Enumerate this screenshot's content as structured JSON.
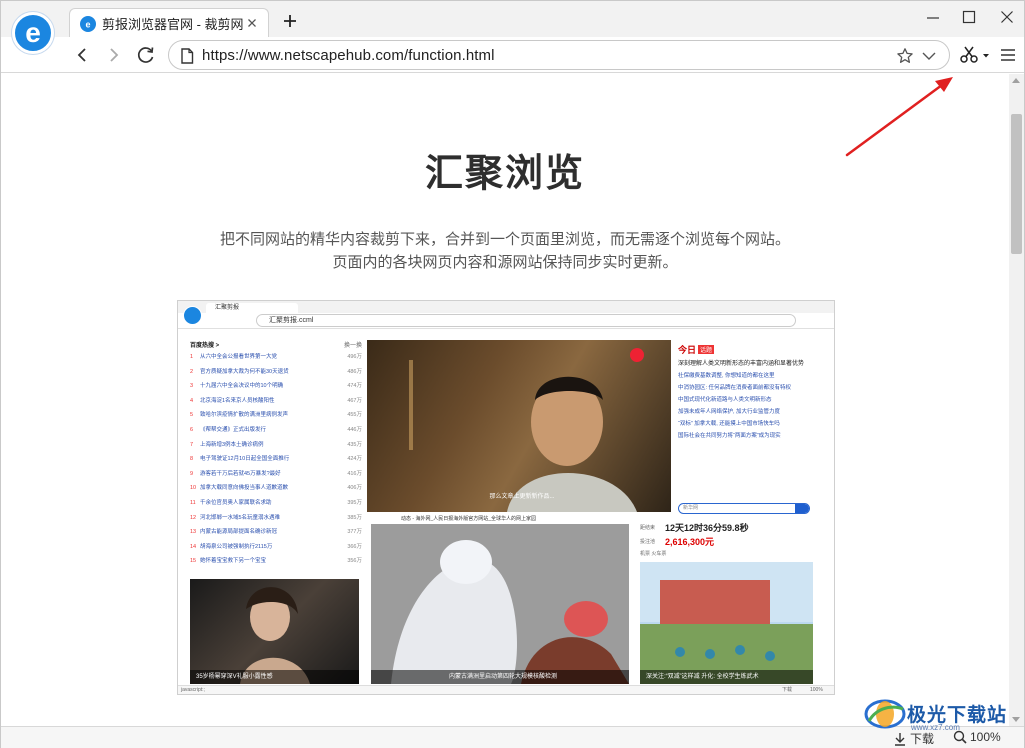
{
  "browser": {
    "tab_title": "剪报浏览器官网 - 裁剪网",
    "url": "https://www.netscapehub.com/function.html",
    "status_download_label": "下载",
    "zoom_level": "100%"
  },
  "icons": [
    "browser-logo-icon",
    "tab-favicon-icon",
    "tab-close-icon",
    "new-tab-icon",
    "minimize-icon",
    "maximize-icon",
    "close-icon",
    "back-icon",
    "forward-icon",
    "refresh-icon",
    "secure-page-icon",
    "star-icon",
    "address-dropdown-icon",
    "scissors-icon",
    "menu-icon",
    "download-icon",
    "zoom-icon",
    "red-annotation-arrow"
  ],
  "page": {
    "heading": "汇聚浏览",
    "description": "把不同网站的精华内容裁剪下来，合并到一个页面里浏览，而无需逐个浏览每个网站。页面内的各块网页内容和源网站保持同步实时更新。"
  },
  "preview": {
    "tab_title": "汇聚剪报",
    "address": "汇聚剪报.ccml",
    "status_text": "javascript:;",
    "status_download": "下载",
    "status_zoom": "100%",
    "hot_list": {
      "title": "百度热搜 >",
      "refresh": "换一换",
      "items": [
        {
          "rank": "1",
          "title": "从六中全会公报看世界第一大党",
          "count": "496万"
        },
        {
          "rank": "2",
          "title": "官方质疑加拿大裁为何不能30天退货",
          "count": "486万"
        },
        {
          "rank": "3",
          "title": "十九届六中全会决议中的10个明确",
          "count": "474万"
        },
        {
          "rank": "4",
          "title": "北京海淀1名来京人员核酸阳性",
          "count": "467万"
        },
        {
          "rank": "5",
          "title": "致哈尔滨疫情扩散的满洲里病例发声",
          "count": "455万"
        },
        {
          "rank": "6",
          "title": "《帮帮交通》正式出版发行",
          "count": "446万"
        },
        {
          "rank": "7",
          "title": "上海新增3例本土确诊病例",
          "count": "435万"
        },
        {
          "rank": "8",
          "title": "电子驾驶证12月10日起全国全面推行",
          "count": "424万"
        },
        {
          "rank": "9",
          "title": "游客若干万后若就45万暴发?最好",
          "count": "416万"
        },
        {
          "rank": "10",
          "title": "加拿大载同意向佛投当事人道歉道歉",
          "count": "406万"
        },
        {
          "rank": "11",
          "title": "千余位官员奥人家属联名求助",
          "count": "395万"
        },
        {
          "rank": "12",
          "title": "河北邯郸一水域5名玩童溺水遇难",
          "count": "385万"
        },
        {
          "rank": "13",
          "title": "内蒙古能源局部提面名确诊新冠",
          "count": "377万"
        },
        {
          "rank": "14",
          "title": "胡海泉公司被强制执行2115万",
          "count": "366万"
        },
        {
          "rank": "15",
          "title": "她怀着宝宝救下另一个宝宝",
          "count": "356万"
        }
      ]
    },
    "photo_main_caption": "那么文章上更新新作品...",
    "photo_fashion_caption": "35岁杨幂穿深V礼服小露性感",
    "photo_nurse_header": "动态 - 海外网_人民日报海外版官方网站_全球华人的网上家园",
    "photo_nurse_caption": "内蒙古满洲里启动第四轮大规模核酸检测",
    "photo_school_caption": "深关注:“双减”这样减 升化: 全校学生练武术",
    "news": {
      "brand": "今日",
      "tag": "话题",
      "lead": "深刻理解人类文明新形态的丰富内涵和显著优势",
      "items": [
        "社保缴费基数调整, 你想知道的都在这里",
        "中消协园区: 任何品牌在消费者面前都没有特权",
        "中国式现代化新道路与人类文明新形态",
        "加强未成年人网络保护, 加大行业监管力度",
        "“双标” 加拿大载, 还能摸上中国市场快车吗",
        "国际社会在共同努力将“两面方案”成为现实"
      ],
      "search_placeholder": "新华网"
    },
    "calendar": {
      "weather_label": "机票",
      "weather_label2": "火车票",
      "row1_label": "距结束",
      "row1_value": "12天12时36分59.8秒",
      "row2_label": "投注池",
      "row2_value": "2,616,300元"
    }
  },
  "watermark": {
    "title": "极光下载站",
    "subtitle": "www.xz7.com"
  }
}
